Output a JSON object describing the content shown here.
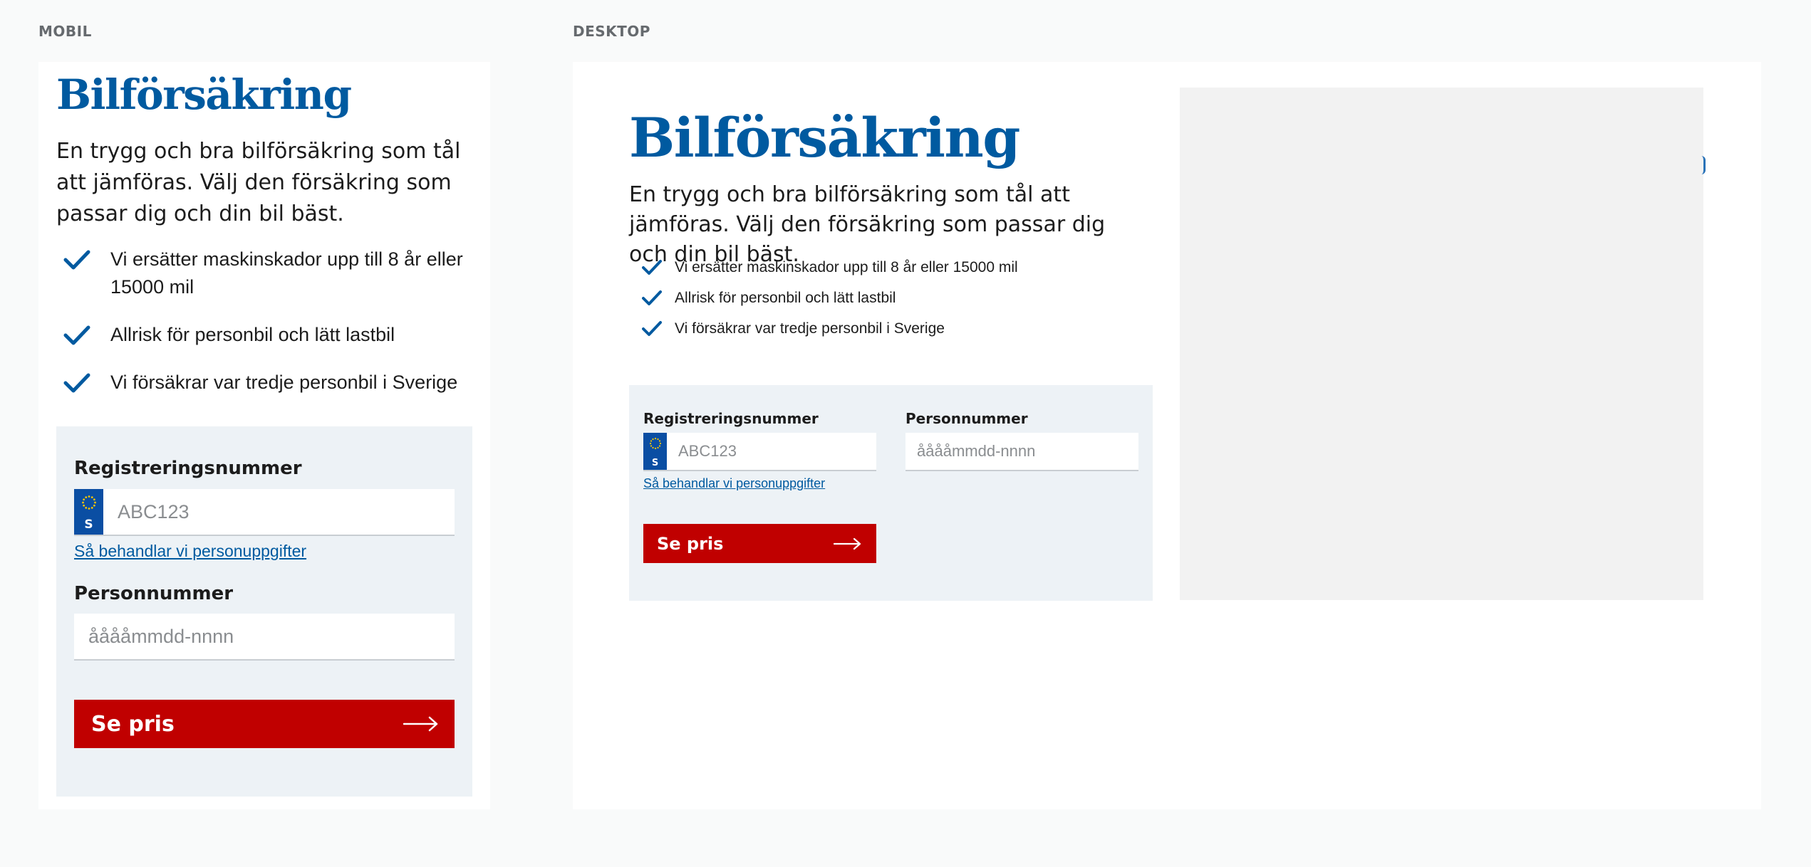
{
  "mobile": {
    "section_label": "MOBIL",
    "title": "Bilförsäkring",
    "lead": "En trygg och bra bilförsäkring som tål att jämföras. Välj den försäkring som passar dig och din bil bäst.",
    "usps": [
      "Vi ersätter maskinskador upp till 8 år eller 15000 mil",
      "Allrisk för personbil och lätt lastbil",
      "Vi försäkrar var tredje personbil i Sverige"
    ],
    "form": {
      "reg_label": "Registreringsnummer",
      "reg_placeholder": "ABC123",
      "plate_country": "S",
      "privacy_link": "Så behandlar vi personuppgifter",
      "pnr_label": "Personnummer",
      "pnr_placeholder": "ååååmmdd-nnnn",
      "cta_label": "Se pris"
    }
  },
  "desktop": {
    "section_label": "DESKTOP",
    "title": "Bilförsäkring",
    "lead": "En trygg och bra bilförsäkring som tål att jämföras. Välj den försäkring som passar dig och din bil bäst.",
    "usps": [
      "Vi ersätter maskinskador upp till 8 år eller 15000 mil",
      "Allrisk för personbil och lätt lastbil",
      "Vi försäkrar var tredje personbil i Sverige"
    ],
    "form": {
      "reg_label": "Registreringsnummer",
      "reg_placeholder": "ABC123",
      "plate_country": "S",
      "privacy_link": "Så behandlar vi personuppgifter",
      "pnr_label": "Personnummer",
      "pnr_placeholder": "ååååmmdd-nnnn",
      "cta_label": "Se pris"
    }
  },
  "icons": {
    "usp": "checkmark-icon",
    "cta": "arrow-right-icon",
    "plate": "eu-stars-icon"
  },
  "colors": {
    "brand_blue": "#005aa0",
    "cta_red": "#c00000",
    "form_bg": "#edf2f6",
    "page_bg": "#f9fafa",
    "image_placeholder": "#f2f2f2"
  }
}
